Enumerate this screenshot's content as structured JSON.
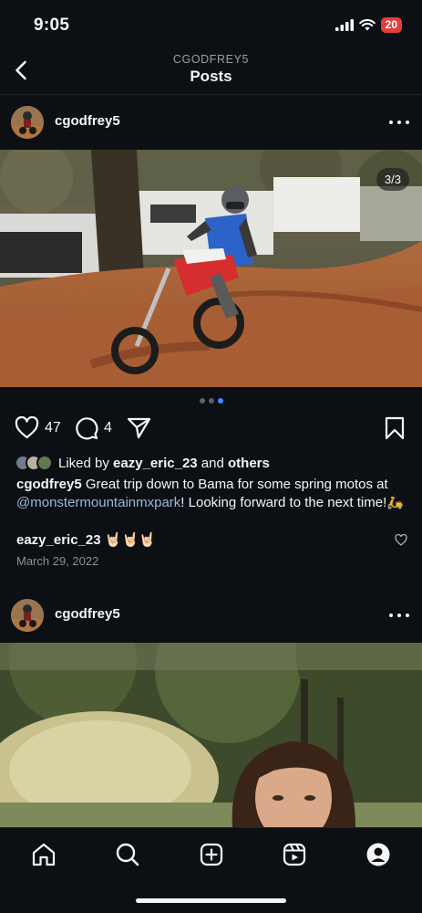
{
  "status": {
    "time": "9:05",
    "battery": "20"
  },
  "header": {
    "account": "CGODFREY5",
    "title": "Posts"
  },
  "posts": [
    {
      "username": "cgodfrey5",
      "photo_counter": "3/3",
      "carousel": {
        "count": 3,
        "active": 3
      },
      "likes": "47",
      "comments": "4",
      "liked_by_prefix": "Liked by ",
      "liked_by_user": "eazy_eric_23",
      "liked_by_and": " and ",
      "liked_by_others": "others",
      "caption_user": "cgodfrey5",
      "caption_text_1": " Great trip down to Bama for some spring motos at ",
      "caption_mention": "@monstermountainmxpark",
      "caption_text_2": "! Looking forward to the next time!🛵",
      "comment_user": "eazy_eric_23",
      "comment_text": " 🤘🏻🤘🏻🤘🏻",
      "date": "March 29, 2022"
    },
    {
      "username": "cgodfrey5"
    }
  ],
  "icons": {
    "back": "chevron-left-icon",
    "like": "heart-icon",
    "comment": "comment-bubble-icon",
    "share": "paper-plane-icon",
    "save": "bookmark-icon",
    "home": "home-icon",
    "search": "search-icon",
    "create": "plus-square-icon",
    "reels": "reels-icon",
    "profile": "profile-icon"
  },
  "colors": {
    "background": "#0c1014",
    "accent": "#3a8ff5",
    "battery": "#e0403a",
    "mention": "#9bb8d8"
  }
}
